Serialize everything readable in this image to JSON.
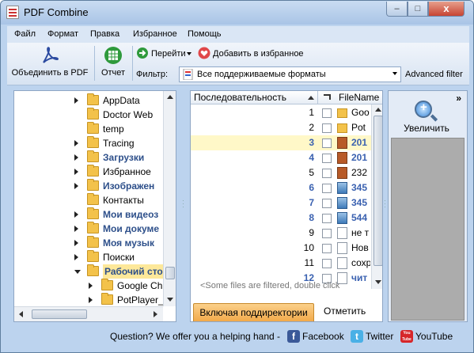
{
  "window": {
    "title": "PDF Combine",
    "controls": {
      "minimize": "–",
      "maximize": "□",
      "close": "x"
    }
  },
  "menu": [
    "Файл",
    "Формат",
    "Правка",
    "Избранное",
    "Помощь"
  ],
  "toolbar": {
    "merge_label": "Объединить в PDF",
    "report_label": "Отчет",
    "goto_label": "Перейти",
    "favorite_label": "Добавить в избранное",
    "filter_label": "Фильтр:",
    "filter_value": "Все поддерживаемые форматы",
    "advanced_filter": "Advanced filter"
  },
  "tree": [
    {
      "label": "AppData",
      "bold": false,
      "arrow": "closed"
    },
    {
      "label": "Doctor Web",
      "bold": false,
      "arrow": "none"
    },
    {
      "label": "temp",
      "bold": false,
      "arrow": "none"
    },
    {
      "label": "Tracing",
      "bold": false,
      "arrow": "closed"
    },
    {
      "label": "Загрузки",
      "bold": true,
      "arrow": "closed"
    },
    {
      "label": "Избранное",
      "bold": false,
      "arrow": "closed"
    },
    {
      "label": "Изображен",
      "bold": true,
      "arrow": "closed"
    },
    {
      "label": "Контакты",
      "bold": false,
      "arrow": "none"
    },
    {
      "label": "Мои видеоз",
      "bold": true,
      "arrow": "closed"
    },
    {
      "label": "Мои докуме",
      "bold": true,
      "arrow": "closed"
    },
    {
      "label": "Моя музык",
      "bold": true,
      "arrow": "closed"
    },
    {
      "label": "Поиски",
      "bold": false,
      "arrow": "closed"
    },
    {
      "label": "Рабочий сто",
      "bold": true,
      "arrow": "open",
      "selected": true
    },
    {
      "label": "Google Ch",
      "bold": false,
      "arrow": "closed",
      "child": true
    },
    {
      "label": "PotPlayer_",
      "bold": false,
      "arrow": "closed",
      "child": true
    }
  ],
  "list": {
    "col_sequence": "Последовательность",
    "col_filename": "FileName",
    "rows": [
      {
        "num": "1",
        "name": "Goo",
        "icon": "folder",
        "bold": false,
        "selected": false
      },
      {
        "num": "2",
        "name": "Pot",
        "icon": "folder",
        "bold": false,
        "selected": false
      },
      {
        "num": "3",
        "name": "201",
        "icon": "image",
        "bold": true,
        "selected": true
      },
      {
        "num": "4",
        "name": "201",
        "icon": "image",
        "bold": true,
        "selected": false
      },
      {
        "num": "5",
        "name": "232",
        "icon": "image",
        "bold": false,
        "selected": false
      },
      {
        "num": "6",
        "name": "345",
        "icon": "image2",
        "bold": true,
        "selected": false
      },
      {
        "num": "7",
        "name": "345",
        "icon": "image2",
        "bold": true,
        "selected": false
      },
      {
        "num": "8",
        "name": "544",
        "icon": "image2",
        "bold": true,
        "selected": false
      },
      {
        "num": "9",
        "name": "не т",
        "icon": "doc",
        "bold": false,
        "selected": false
      },
      {
        "num": "10",
        "name": "Нов",
        "icon": "doc",
        "bold": false,
        "selected": false
      },
      {
        "num": "11",
        "name": "сохр",
        "icon": "doc",
        "bold": false,
        "selected": false
      },
      {
        "num": "12",
        "name": "чит",
        "icon": "doc",
        "bold": true,
        "selected": false
      }
    ],
    "filtered_msg": "<Some files are filtered, double click",
    "subdirs_button": "Включая поддиректории",
    "mark_button": "Отметить"
  },
  "side": {
    "zoom_label": "Увеличить",
    "expand": "»"
  },
  "status": {
    "text": "Question? We offer you a helping hand -",
    "facebook": "Facebook",
    "twitter": "Twitter",
    "youtube": "YouTube",
    "facebook_glyph": "f",
    "twitter_glyph": "t",
    "youtube_glyph": "You Tube"
  },
  "colors": {
    "accent": "#3a61b0",
    "selected_row": "#fff8c8",
    "button_orange": "#f1a848"
  }
}
